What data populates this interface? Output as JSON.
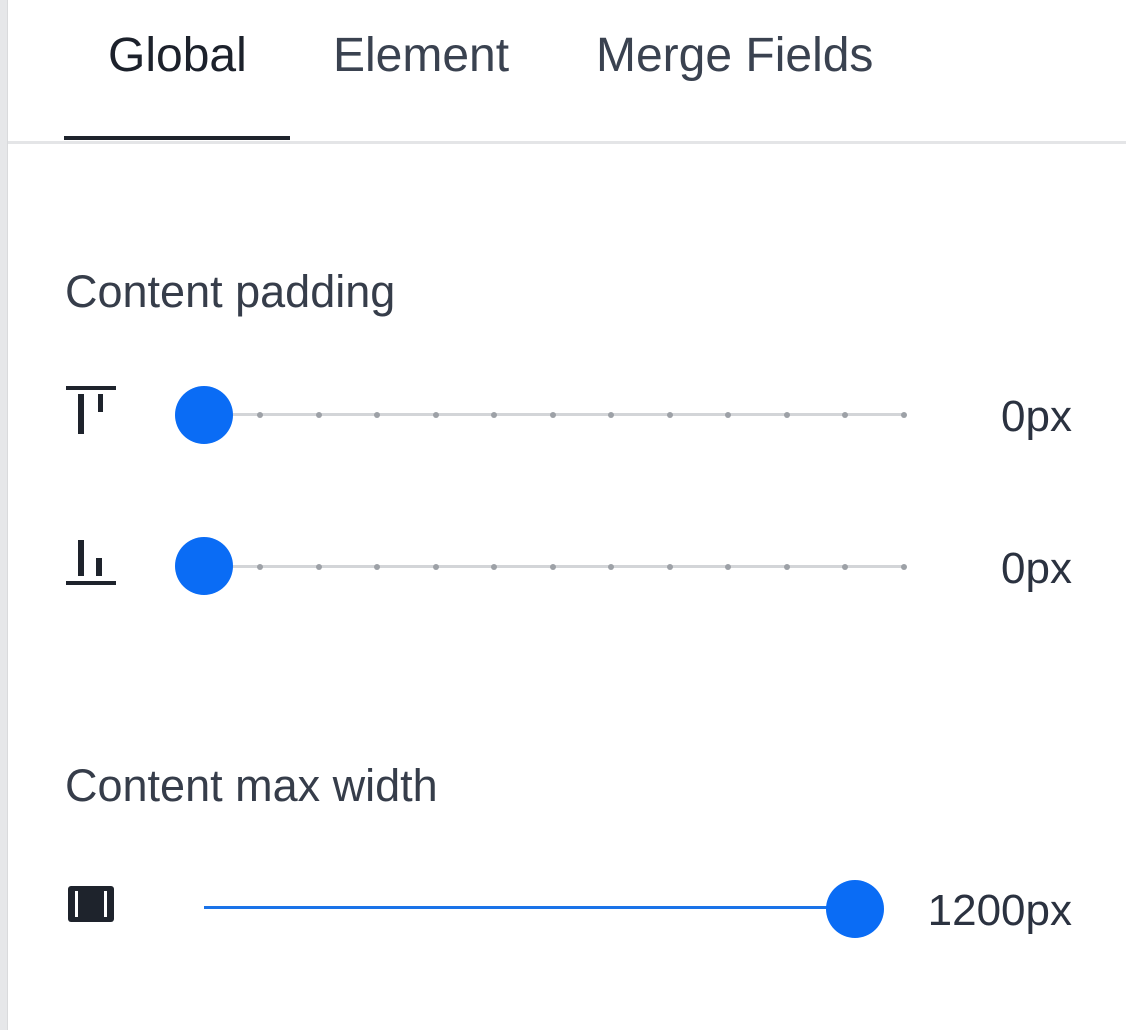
{
  "tabs": [
    {
      "label": "Global",
      "active": true
    },
    {
      "label": "Element",
      "active": false
    },
    {
      "label": "Merge Fields",
      "active": false
    }
  ],
  "content_padding": {
    "title": "Content padding",
    "top": {
      "icon": "padding-top-icon",
      "value": 0,
      "value_text": "0px"
    },
    "bottom": {
      "icon": "padding-bottom-icon",
      "value": 0,
      "value_text": "0px"
    }
  },
  "content_max_width": {
    "title": "Content max width",
    "icon": "width-icon",
    "value": 1200,
    "value_text": "1200px",
    "fraction": 1.0
  },
  "colors": {
    "accent": "#0a6cf5",
    "track": "#d3d5d8",
    "text": "#2f3542"
  }
}
